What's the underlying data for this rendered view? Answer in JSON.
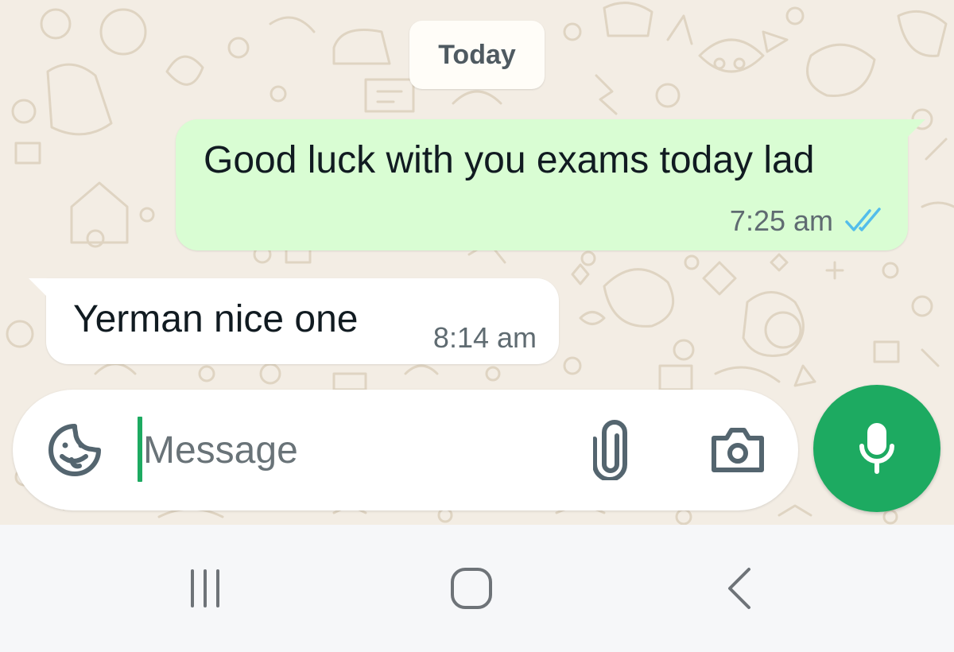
{
  "chat": {
    "date_label": "Today",
    "messages": [
      {
        "direction": "outgoing",
        "text": "Good luck with you exams today lad",
        "time": "7:25 am",
        "status": "read",
        "status_icon": "double-check-icon"
      },
      {
        "direction": "incoming",
        "text": "Yerman nice one",
        "time": "8:14 am"
      }
    ]
  },
  "composer": {
    "placeholder": "Message",
    "value": "",
    "icons": {
      "emoji": "sticker-emoji-icon",
      "attach": "paperclip-icon",
      "camera": "camera-icon",
      "mic": "microphone-icon"
    }
  },
  "navigation": {
    "buttons": [
      "recent-apps",
      "home",
      "back"
    ]
  },
  "colors": {
    "wallpaper": "#f3ede4",
    "outgoing_bubble": "#d9fdd3",
    "incoming_bubble": "#ffffff",
    "accent_green": "#1daa61",
    "read_ticks": "#53bdeb",
    "nav_bar": "#f6f7f9"
  }
}
